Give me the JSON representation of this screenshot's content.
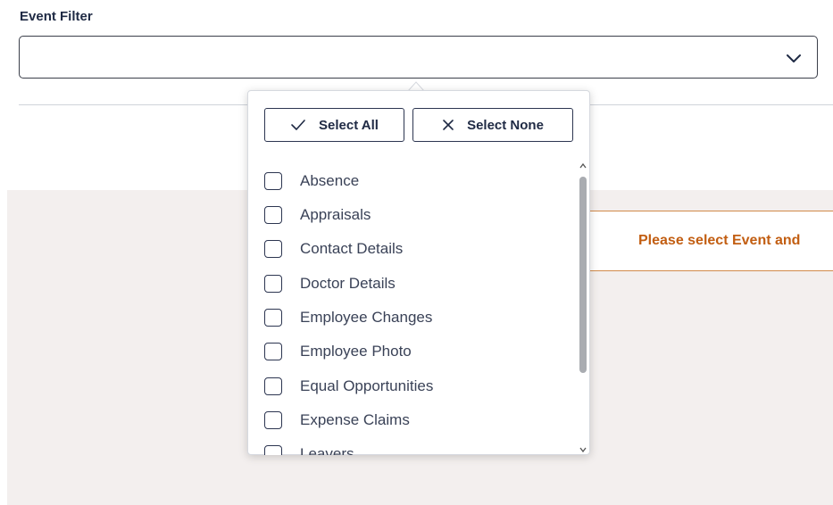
{
  "event_filter": {
    "label": "Event Filter",
    "value": ""
  },
  "dropdown": {
    "select_all_label": "Select All",
    "select_none_label": "Select None",
    "options": [
      {
        "label": "Absence",
        "checked": false
      },
      {
        "label": "Appraisals",
        "checked": false
      },
      {
        "label": "Contact Details",
        "checked": false
      },
      {
        "label": "Doctor Details",
        "checked": false
      },
      {
        "label": "Employee Changes",
        "checked": false
      },
      {
        "label": "Employee Photo",
        "checked": false
      },
      {
        "label": "Equal Opportunities",
        "checked": false
      },
      {
        "label": "Expense Claims",
        "checked": false
      },
      {
        "label": "Leavers",
        "checked": false
      }
    ]
  },
  "notice": {
    "text": "Please select Event and"
  },
  "colors": {
    "accent_text": "#c25e12",
    "notice_border": "#d18a4a",
    "content_bg": "#f3efee"
  },
  "icons": {
    "dropdown": "chevron-down-icon",
    "select_all": "check-icon",
    "select_none": "close-icon"
  }
}
